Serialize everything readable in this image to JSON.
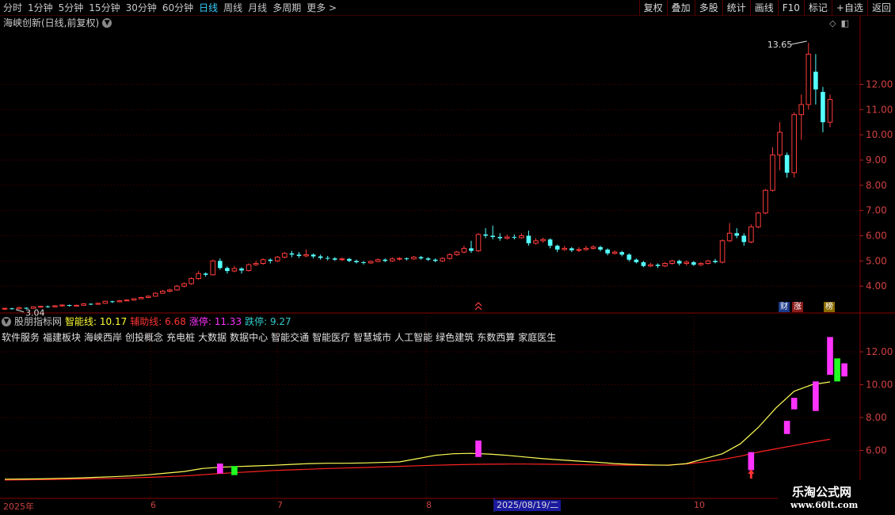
{
  "toolbar": {
    "periods": [
      "分时",
      "1分钟",
      "5分钟",
      "15分钟",
      "30分钟",
      "60分钟",
      "日线",
      "周线",
      "月线",
      "多周期",
      "更多 >"
    ],
    "active_period": "日线",
    "right_buttons": [
      "复权",
      "叠加",
      "多股",
      "统计",
      "画线",
      "F10",
      "标记",
      "+自选",
      "返回"
    ]
  },
  "stock": {
    "title": "海峡创新(日线,前复权)",
    "high_label": "13.65",
    "low_label": "3.04"
  },
  "main_axis": {
    "ticks": [
      "12.00",
      "11.00",
      "10.00",
      "9.00",
      "8.00",
      "7.00",
      "6.00",
      "5.00",
      "4.00"
    ]
  },
  "badges": {
    "cai": "财",
    "zhang": "涨",
    "bang": "榜"
  },
  "indicator": {
    "name": "股朋指标网",
    "smart_label": "智能线:",
    "smart_value": "10.17",
    "aux_label": "辅助线:",
    "aux_value": "6.68",
    "up_label": "涨停:",
    "up_value": "11.33",
    "down_label": "跌停:",
    "down_value": "9.27",
    "ticks": [
      "12.00",
      "10.00",
      "8.00",
      "6.00"
    ]
  },
  "concepts": [
    "软件服务",
    "福建板块",
    "海峡西岸",
    "创投概念",
    "充电桩",
    "大数据",
    "数据中心",
    "智能交通",
    "智能医疗",
    "智慧城市",
    "人工智能",
    "绿色建筑",
    "东数西算",
    "家庭医生"
  ],
  "date_axis": {
    "labels": [
      "2025年",
      "6",
      "7",
      "8",
      "10"
    ],
    "highlight": "2025/08/19/二"
  },
  "watermark": {
    "title": "乐淘公式网",
    "url": "www.60lt.com"
  },
  "colors": {
    "up": "#ff3b3b",
    "down": "#54ffff",
    "smart_line": "#ffff55",
    "aux_line": "#ff2222",
    "magenta": "#ff33ff",
    "green": "#22ff22"
  },
  "chart_data": {
    "type": "candlestick",
    "price_range": [
      3.0,
      13.9
    ],
    "candles": [
      [
        3.1,
        3.12,
        3.05,
        3.15
      ],
      [
        3.12,
        3.1,
        3.07,
        3.14
      ],
      [
        3.1,
        3.15,
        3.08,
        3.18
      ],
      [
        3.14,
        3.12,
        3.09,
        3.16
      ],
      [
        3.12,
        3.18,
        3.1,
        3.2
      ],
      [
        3.18,
        3.2,
        3.15,
        3.22
      ],
      [
        3.2,
        3.18,
        3.14,
        3.23
      ],
      [
        3.18,
        3.22,
        3.16,
        3.25
      ],
      [
        3.22,
        3.25,
        3.18,
        3.28
      ],
      [
        3.25,
        3.22,
        3.19,
        3.27
      ],
      [
        3.22,
        3.24,
        3.2,
        3.27
      ],
      [
        3.24,
        3.3,
        3.22,
        3.33
      ],
      [
        3.3,
        3.28,
        3.25,
        3.32
      ],
      [
        3.28,
        3.32,
        3.26,
        3.35
      ],
      [
        3.32,
        3.4,
        3.3,
        3.43
      ],
      [
        3.4,
        3.38,
        3.33,
        3.42
      ],
      [
        3.38,
        3.42,
        3.36,
        3.45
      ],
      [
        3.42,
        3.45,
        3.4,
        3.48
      ],
      [
        3.45,
        3.5,
        3.42,
        3.52
      ],
      [
        3.5,
        3.55,
        3.48,
        3.58
      ],
      [
        3.55,
        3.6,
        3.52,
        3.64
      ],
      [
        3.6,
        3.72,
        3.58,
        3.75
      ],
      [
        3.72,
        3.8,
        3.7,
        3.85
      ],
      [
        3.8,
        3.85,
        3.76,
        3.9
      ],
      [
        3.85,
        4.0,
        3.82,
        4.05
      ],
      [
        4.0,
        4.1,
        3.95,
        4.15
      ],
      [
        4.1,
        4.3,
        4.05,
        4.35
      ],
      [
        4.3,
        4.5,
        4.25,
        4.6
      ],
      [
        4.5,
        4.45,
        4.38,
        4.55
      ],
      [
        4.45,
        5.0,
        4.42,
        5.05
      ],
      [
        5.0,
        4.72,
        4.65,
        5.1
      ],
      [
        4.72,
        4.6,
        4.5,
        4.78
      ],
      [
        4.6,
        4.7,
        4.55,
        4.8
      ],
      [
        4.7,
        4.62,
        4.5,
        4.75
      ],
      [
        4.62,
        4.85,
        4.58,
        4.9
      ],
      [
        4.85,
        4.9,
        4.8,
        5.0
      ],
      [
        4.9,
        5.05,
        4.85,
        5.1
      ],
      [
        5.05,
        5.0,
        4.9,
        5.1
      ],
      [
        5.0,
        5.15,
        4.95,
        5.2
      ],
      [
        5.15,
        5.3,
        5.1,
        5.35
      ],
      [
        5.3,
        5.25,
        5.15,
        5.4
      ],
      [
        5.25,
        5.2,
        5.12,
        5.35
      ],
      [
        5.2,
        5.25,
        5.15,
        5.45
      ],
      [
        5.25,
        5.18,
        5.1,
        5.3
      ],
      [
        5.18,
        5.12,
        5.05,
        5.25
      ],
      [
        5.12,
        5.1,
        5.02,
        5.2
      ],
      [
        5.1,
        5.05,
        5.0,
        5.15
      ],
      [
        5.05,
        5.08,
        5.0,
        5.14
      ],
      [
        5.08,
        5.0,
        4.95,
        5.12
      ],
      [
        5.0,
        4.95,
        4.9,
        5.05
      ],
      [
        4.95,
        4.92,
        4.86,
        5.0
      ],
      [
        4.92,
        4.98,
        4.88,
        5.02
      ],
      [
        4.98,
        5.05,
        4.95,
        5.1
      ],
      [
        5.05,
        5.0,
        4.95,
        5.1
      ],
      [
        5.0,
        5.08,
        4.96,
        5.14
      ],
      [
        5.08,
        5.1,
        5.02,
        5.15
      ],
      [
        5.1,
        5.08,
        5.02,
        5.14
      ],
      [
        5.08,
        5.15,
        5.05,
        5.2
      ],
      [
        5.15,
        5.1,
        5.05,
        5.2
      ],
      [
        5.1,
        5.05,
        5.0,
        5.15
      ],
      [
        5.05,
        5.0,
        4.95,
        5.1
      ],
      [
        5.0,
        5.1,
        4.96,
        5.15
      ],
      [
        5.1,
        5.25,
        5.05,
        5.3
      ],
      [
        5.25,
        5.35,
        5.2,
        5.4
      ],
      [
        5.35,
        5.5,
        5.3,
        5.6
      ],
      [
        5.5,
        5.4,
        5.32,
        5.8
      ],
      [
        5.4,
        6.05,
        5.35,
        6.1
      ],
      [
        6.05,
        6.0,
        5.9,
        6.3
      ],
      [
        6.0,
        5.95,
        5.85,
        6.4
      ],
      [
        5.95,
        5.9,
        5.8,
        6.1
      ],
      [
        5.9,
        5.95,
        5.85,
        6.05
      ],
      [
        5.95,
        5.92,
        5.85,
        6.05
      ],
      [
        5.92,
        6.0,
        5.88,
        6.1
      ],
      [
        6.0,
        5.7,
        5.6,
        6.2
      ],
      [
        5.7,
        5.8,
        5.65,
        5.9
      ],
      [
        5.8,
        5.85,
        5.72,
        5.92
      ],
      [
        5.85,
        5.6,
        5.5,
        5.9
      ],
      [
        5.6,
        5.45,
        5.35,
        5.65
      ],
      [
        5.45,
        5.5,
        5.4,
        5.6
      ],
      [
        5.5,
        5.42,
        5.35,
        5.55
      ],
      [
        5.42,
        5.45,
        5.35,
        5.55
      ],
      [
        5.45,
        5.5,
        5.4,
        5.6
      ],
      [
        5.5,
        5.55,
        5.45,
        5.62
      ],
      [
        5.55,
        5.45,
        5.38,
        5.6
      ],
      [
        5.45,
        5.3,
        5.22,
        5.5
      ],
      [
        5.3,
        5.35,
        5.25,
        5.42
      ],
      [
        5.35,
        5.25,
        5.18,
        5.4
      ],
      [
        5.25,
        5.05,
        4.98,
        5.3
      ],
      [
        5.05,
        4.95,
        4.9,
        5.1
      ],
      [
        4.95,
        4.8,
        4.75,
        5.0
      ],
      [
        4.8,
        4.85,
        4.75,
        4.92
      ],
      [
        4.85,
        4.8,
        4.72,
        4.9
      ],
      [
        4.8,
        4.9,
        4.75,
        4.95
      ],
      [
        4.9,
        5.0,
        4.85,
        5.05
      ],
      [
        5.0,
        4.9,
        4.82,
        5.05
      ],
      [
        4.9,
        4.95,
        4.82,
        5.02
      ],
      [
        4.95,
        4.85,
        4.8,
        5.0
      ],
      [
        4.85,
        4.9,
        4.8,
        4.95
      ],
      [
        4.9,
        5.0,
        4.86,
        5.05
      ],
      [
        5.0,
        4.95,
        4.9,
        5.08
      ],
      [
        4.95,
        5.8,
        4.9,
        5.85
      ],
      [
        5.8,
        6.1,
        5.75,
        6.5
      ],
      [
        6.1,
        6.0,
        5.9,
        6.3
      ],
      [
        6.0,
        5.75,
        5.6,
        6.1
      ],
      [
        5.75,
        6.35,
        5.7,
        6.45
      ],
      [
        6.35,
        6.9,
        6.3,
        6.95
      ],
      [
        6.9,
        7.8,
        6.85,
        7.85
      ],
      [
        7.8,
        9.2,
        7.75,
        9.5
      ],
      [
        9.2,
        10.1,
        8.6,
        10.5
      ],
      [
        9.2,
        8.5,
        8.3,
        9.3
      ],
      [
        8.5,
        10.8,
        8.3,
        10.9
      ],
      [
        10.8,
        11.2,
        9.8,
        11.6
      ],
      [
        11.2,
        13.2,
        11.0,
        13.65
      ],
      [
        12.5,
        11.8,
        11.2,
        13.2
      ],
      [
        11.7,
        10.5,
        10.1,
        11.9
      ],
      [
        10.5,
        11.4,
        10.3,
        11.6
      ]
    ],
    "smart_line": [
      4.25,
      4.26,
      4.27,
      4.3,
      4.32,
      4.36,
      4.4,
      4.45,
      4.52,
      4.62,
      4.72,
      4.9,
      4.98,
      5.02,
      5.06,
      5.1,
      5.15,
      5.2,
      5.22,
      5.22,
      5.24,
      5.27,
      5.3,
      5.5,
      5.7,
      5.8,
      5.82,
      5.78,
      5.7,
      5.6,
      5.5,
      5.42,
      5.35,
      5.28,
      5.2,
      5.15,
      5.12,
      5.1,
      5.2,
      5.5,
      5.8,
      6.4,
      7.4,
      8.6,
      9.6,
      10.0,
      10.17
    ],
    "aux_line": [
      4.2,
      4.21,
      4.22,
      4.24,
      4.26,
      4.28,
      4.3,
      4.33,
      4.36,
      4.4,
      4.45,
      4.52,
      4.6,
      4.66,
      4.72,
      4.78,
      4.82,
      4.86,
      4.9,
      4.93,
      4.96,
      5.0,
      5.03,
      5.07,
      5.1,
      5.13,
      5.15,
      5.16,
      5.17,
      5.17,
      5.16,
      5.15,
      5.14,
      5.12,
      5.11,
      5.1,
      5.1,
      5.12,
      5.18,
      5.3,
      5.45,
      5.65,
      5.9,
      6.1,
      6.3,
      6.5,
      6.68
    ],
    "signals": [
      {
        "idx": 30,
        "lo": 4.6,
        "hi": 5.2,
        "color": "magenta"
      },
      {
        "idx": 32,
        "lo": 4.5,
        "hi": 5.05,
        "color": "green"
      },
      {
        "idx": 66,
        "lo": 5.6,
        "hi": 6.6,
        "color": "magenta"
      },
      {
        "idx": 104,
        "lo": 4.8,
        "hi": 5.9,
        "color": "magenta"
      },
      {
        "idx": 109,
        "lo": 7.0,
        "hi": 7.8,
        "color": "magenta"
      },
      {
        "idx": 110,
        "lo": 8.5,
        "hi": 9.2,
        "color": "magenta"
      },
      {
        "idx": 113,
        "lo": 8.4,
        "hi": 10.2,
        "color": "magenta"
      },
      {
        "idx": 115,
        "lo": 10.6,
        "hi": 12.9,
        "color": "magenta"
      },
      {
        "idx": 116,
        "lo": 10.2,
        "hi": 11.6,
        "color": "green"
      },
      {
        "idx": 117,
        "lo": 10.5,
        "hi": 11.3,
        "color": "magenta"
      }
    ]
  }
}
